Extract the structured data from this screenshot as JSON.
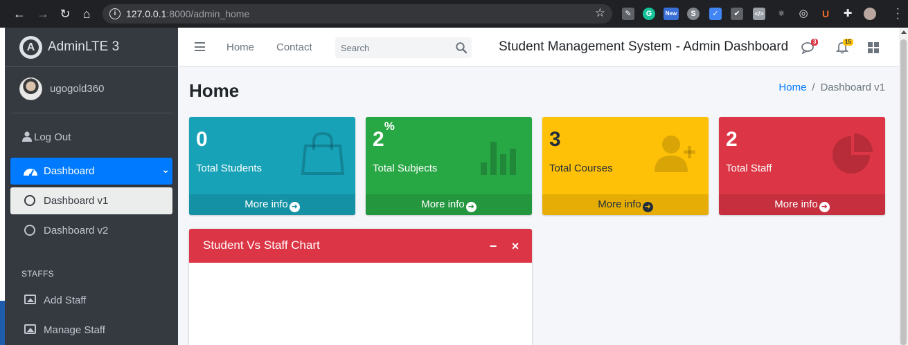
{
  "browser": {
    "url_host": "127.0.0.1",
    "url_rest": ":8000/admin_home",
    "extension_new_label": "New"
  },
  "sidebar": {
    "brand": "AdminLTE 3",
    "brand_letter": "A",
    "user_name": "ugogold360",
    "logout_label": "Log Out",
    "items": [
      {
        "label": "Dashboard"
      },
      {
        "label": "Dashboard v1"
      },
      {
        "label": "Dashboard v2"
      }
    ],
    "section_header": "STAFFS",
    "staff_items": [
      {
        "label": "Add Staff"
      },
      {
        "label": "Manage Staff"
      }
    ]
  },
  "navbar": {
    "home_link": "Home",
    "contact_link": "Contact",
    "search_placeholder": "Search",
    "title": "Student Management System - Admin Dashboard",
    "messages_badge": "3",
    "notifications_badge": "15"
  },
  "content": {
    "page_title": "Home",
    "breadcrumb_home": "Home",
    "breadcrumb_current": "Dashboard v1",
    "boxes": [
      {
        "value": "0",
        "label": "Total Students",
        "footer": "More info",
        "color": "#17a2b8",
        "icon": "shopping-bag-icon"
      },
      {
        "value": "2",
        "suffix": "%",
        "label": "Total Subjects",
        "footer": "More info",
        "color": "#28a745",
        "icon": "bar-chart-icon"
      },
      {
        "value": "3",
        "label": "Total Courses",
        "footer": "More info",
        "color": "#ffc107",
        "icon": "user-plus-icon"
      },
      {
        "value": "2",
        "label": "Total Staff",
        "footer": "More info",
        "color": "#dc3545",
        "icon": "pie-chart-icon"
      }
    ],
    "chart_card": {
      "title": "Student Vs Staff Chart",
      "collapse_symbol": "−",
      "close_symbol": "×"
    }
  }
}
